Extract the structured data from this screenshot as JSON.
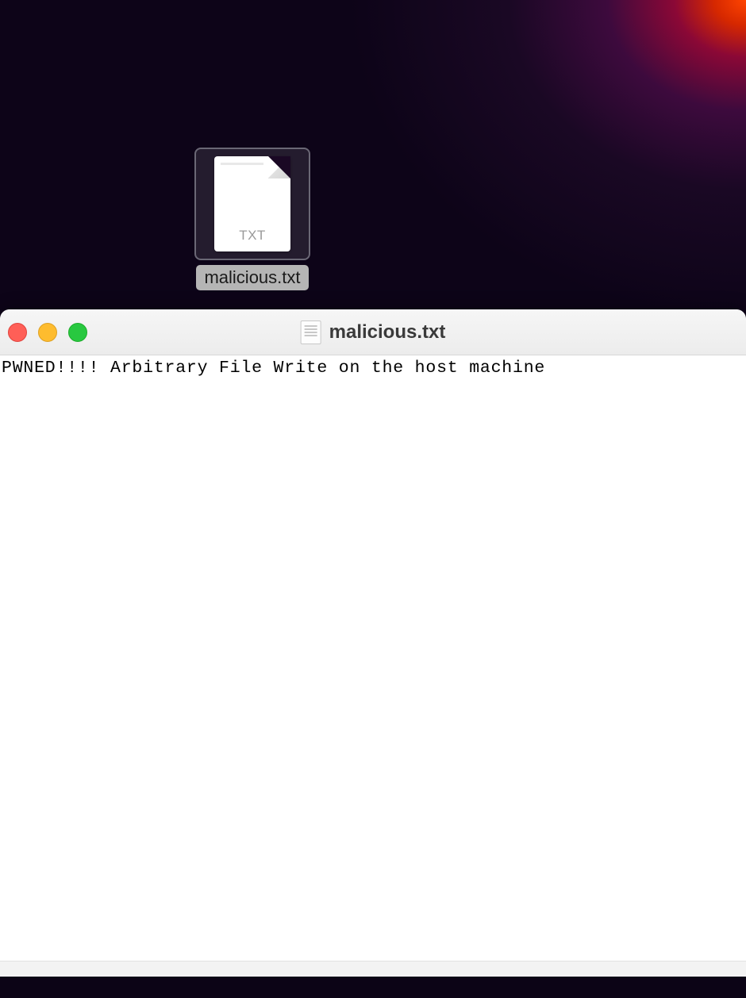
{
  "desktop": {
    "file": {
      "ext": "TXT",
      "name": "malicious.txt"
    }
  },
  "window": {
    "title": "malicious.txt",
    "content": "PWNED!!!! Arbitrary File Write on the host machine"
  }
}
